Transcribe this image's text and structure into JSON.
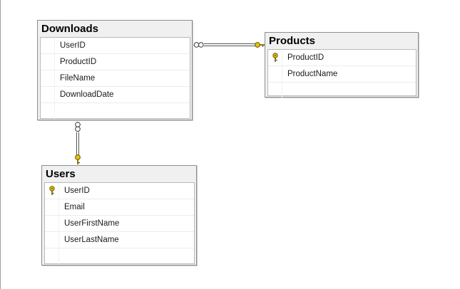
{
  "tables": {
    "downloads": {
      "name": "Downloads",
      "columns": [
        {
          "name": "UserID",
          "primary_key": false
        },
        {
          "name": "ProductID",
          "primary_key": false
        },
        {
          "name": "FileName",
          "primary_key": false
        },
        {
          "name": "DownloadDate",
          "primary_key": false
        }
      ]
    },
    "products": {
      "name": "Products",
      "columns": [
        {
          "name": "ProductID",
          "primary_key": true
        },
        {
          "name": "ProductName",
          "primary_key": false
        }
      ]
    },
    "users": {
      "name": "Users",
      "columns": [
        {
          "name": "UserID",
          "primary_key": true
        },
        {
          "name": "Email",
          "primary_key": false
        },
        {
          "name": "UserFirstName",
          "primary_key": false
        },
        {
          "name": "UserLastName",
          "primary_key": false
        }
      ]
    }
  },
  "relationships": [
    {
      "from": "Downloads",
      "to": "Products",
      "from_end": "many",
      "to_end": "one"
    },
    {
      "from": "Downloads",
      "to": "Users",
      "from_end": "many",
      "to_end": "one"
    }
  ],
  "colors": {
    "key_icon": "#e8c200",
    "line": "#555555",
    "table_header": "#f0f0f0",
    "table_border": "#8e8e8e"
  }
}
